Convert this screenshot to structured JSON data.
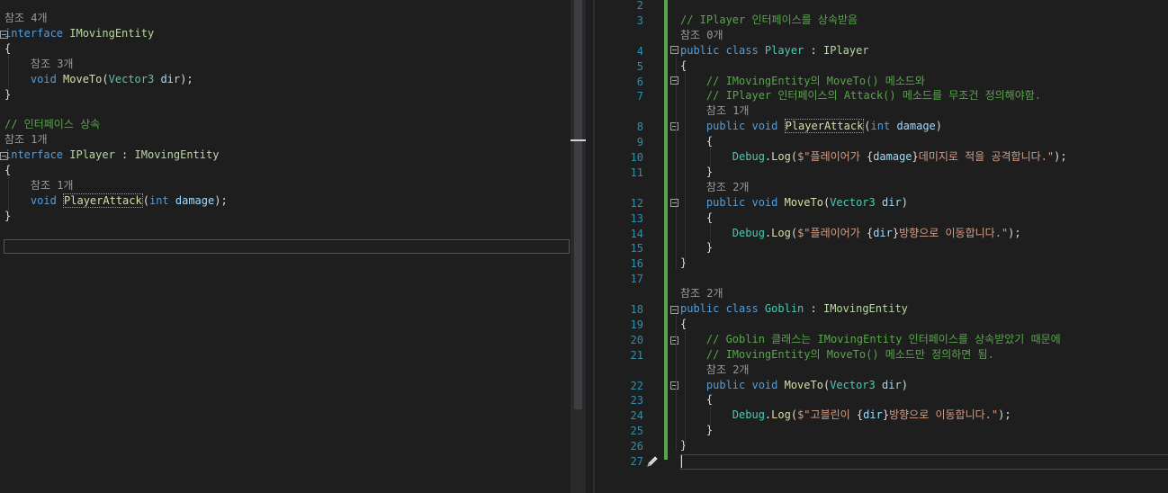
{
  "left_editor": {
    "lines": [
      [
        {
          "t": "참조 4개",
          "c": "lens"
        }
      ],
      [
        {
          "t": "interface ",
          "c": "kw"
        },
        {
          "t": "IMovingEntity",
          "c": "iface"
        }
      ],
      [
        {
          "t": "{",
          "c": "plain"
        }
      ],
      [
        {
          "t": "    참조 3개",
          "c": "lens"
        }
      ],
      [
        {
          "t": "    void ",
          "c": "kw"
        },
        {
          "t": "MoveTo",
          "c": "fn"
        },
        {
          "t": "(",
          "c": "plain"
        },
        {
          "t": "Vector3",
          "c": "cls"
        },
        {
          "t": " ",
          "c": "plain"
        },
        {
          "t": "dir",
          "c": "param"
        },
        {
          "t": ");",
          "c": "plain"
        }
      ],
      [
        {
          "t": "}",
          "c": "plain"
        }
      ],
      [],
      [
        {
          "t": "// 인터페이스 상속",
          "c": "cm"
        }
      ],
      [
        {
          "t": "참조 1개",
          "c": "lens"
        }
      ],
      [
        {
          "t": "interface ",
          "c": "kw"
        },
        {
          "t": "IPlayer",
          "c": "iface"
        },
        {
          "t": " : ",
          "c": "plain"
        },
        {
          "t": "IMovingEntity",
          "c": "iface"
        }
      ],
      [
        {
          "t": "{",
          "c": "plain"
        }
      ],
      [
        {
          "t": "    참조 1개",
          "c": "lens"
        }
      ],
      [
        {
          "t": "    void ",
          "c": "kw"
        },
        {
          "t": "PlayerAttack",
          "c": "fn",
          "dotted": true
        },
        {
          "t": "(",
          "c": "plain"
        },
        {
          "t": "int ",
          "c": "kw"
        },
        {
          "t": "damage",
          "c": "param"
        },
        {
          "t": ");",
          "c": "plain"
        }
      ],
      [
        {
          "t": "}",
          "c": "plain"
        }
      ]
    ]
  },
  "right_editor": {
    "lines": [
      {
        "n": "2",
        "seg": []
      },
      {
        "n": "3",
        "seg": [
          {
            "t": "// IPlayer 인터페이스를 상속받음",
            "c": "cm"
          }
        ]
      },
      {
        "n": "",
        "seg": [
          {
            "t": "참조 0개",
            "c": "lens"
          }
        ]
      },
      {
        "n": "4",
        "seg": [
          {
            "t": "public class ",
            "c": "kw"
          },
          {
            "t": "Player",
            "c": "cls"
          },
          {
            "t": " : ",
            "c": "plain"
          },
          {
            "t": "IPlayer",
            "c": "iface"
          }
        ]
      },
      {
        "n": "5",
        "seg": [
          {
            "t": "{",
            "c": "plain"
          }
        ]
      },
      {
        "n": "6",
        "seg": [
          {
            "t": "    // IMovingEntity의 MoveTo() 메소드와",
            "c": "cm"
          }
        ]
      },
      {
        "n": "7",
        "seg": [
          {
            "t": "    // IPlayer 인터페이스의 Attack() 메소드를 무조건 정의해야함.",
            "c": "cm"
          }
        ]
      },
      {
        "n": "",
        "seg": [
          {
            "t": "    참조 1개",
            "c": "lens"
          }
        ]
      },
      {
        "n": "8",
        "seg": [
          {
            "t": "    public void ",
            "c": "kw"
          },
          {
            "t": "PlayerAttack",
            "c": "fn",
            "dotted": true
          },
          {
            "t": "(",
            "c": "plain"
          },
          {
            "t": "int ",
            "c": "kw"
          },
          {
            "t": "damage",
            "c": "param"
          },
          {
            "t": ")",
            "c": "plain"
          }
        ]
      },
      {
        "n": "9",
        "seg": [
          {
            "t": "    {",
            "c": "plain"
          }
        ]
      },
      {
        "n": "10",
        "seg": [
          {
            "t": "        ",
            "c": "plain"
          },
          {
            "t": "Debug",
            "c": "cls"
          },
          {
            "t": ".",
            "c": "plain"
          },
          {
            "t": "Log",
            "c": "fn"
          },
          {
            "t": "(",
            "c": "plain"
          },
          {
            "t": "$\"플레이어가 ",
            "c": "str"
          },
          {
            "t": "{",
            "c": "plain"
          },
          {
            "t": "damage",
            "c": "param"
          },
          {
            "t": "}",
            "c": "plain"
          },
          {
            "t": "데미지로 적을 공격합니다.\"",
            "c": "str"
          },
          {
            "t": ");",
            "c": "plain"
          }
        ]
      },
      {
        "n": "11",
        "seg": [
          {
            "t": "    }",
            "c": "plain"
          }
        ]
      },
      {
        "n": "",
        "seg": [
          {
            "t": "    참조 2개",
            "c": "lens"
          }
        ]
      },
      {
        "n": "12",
        "seg": [
          {
            "t": "    public void ",
            "c": "kw"
          },
          {
            "t": "MoveTo",
            "c": "fn"
          },
          {
            "t": "(",
            "c": "plain"
          },
          {
            "t": "Vector3",
            "c": "cls"
          },
          {
            "t": " ",
            "c": "plain"
          },
          {
            "t": "dir",
            "c": "param"
          },
          {
            "t": ")",
            "c": "plain"
          }
        ]
      },
      {
        "n": "13",
        "seg": [
          {
            "t": "    {",
            "c": "plain"
          }
        ]
      },
      {
        "n": "14",
        "seg": [
          {
            "t": "        ",
            "c": "plain"
          },
          {
            "t": "Debug",
            "c": "cls"
          },
          {
            "t": ".",
            "c": "plain"
          },
          {
            "t": "Log",
            "c": "fn"
          },
          {
            "t": "(",
            "c": "plain"
          },
          {
            "t": "$\"플레이어가 ",
            "c": "str"
          },
          {
            "t": "{",
            "c": "plain"
          },
          {
            "t": "dir",
            "c": "param"
          },
          {
            "t": "}",
            "c": "plain"
          },
          {
            "t": "방향으로 이동합니다.\"",
            "c": "str"
          },
          {
            "t": ");",
            "c": "plain"
          }
        ]
      },
      {
        "n": "15",
        "seg": [
          {
            "t": "    }",
            "c": "plain"
          }
        ]
      },
      {
        "n": "16",
        "seg": [
          {
            "t": "}",
            "c": "plain"
          }
        ]
      },
      {
        "n": "17",
        "seg": []
      },
      {
        "n": "",
        "seg": [
          {
            "t": "참조 2개",
            "c": "lens"
          }
        ]
      },
      {
        "n": "18",
        "seg": [
          {
            "t": "public class ",
            "c": "kw"
          },
          {
            "t": "Goblin",
            "c": "cls"
          },
          {
            "t": " : ",
            "c": "plain"
          },
          {
            "t": "IMovingEntity",
            "c": "iface"
          }
        ]
      },
      {
        "n": "19",
        "seg": [
          {
            "t": "{",
            "c": "plain"
          }
        ]
      },
      {
        "n": "20",
        "seg": [
          {
            "t": "    // Goblin 클래스는 IMovingEntity 인터페이스를 상속받았기 때문에",
            "c": "cm"
          }
        ]
      },
      {
        "n": "21",
        "seg": [
          {
            "t": "    // IMovingEntity의 MoveTo() 메소드만 정의하면 됨.",
            "c": "cm"
          }
        ]
      },
      {
        "n": "",
        "seg": [
          {
            "t": "    참조 2개",
            "c": "lens"
          }
        ]
      },
      {
        "n": "22",
        "seg": [
          {
            "t": "    public void ",
            "c": "kw"
          },
          {
            "t": "MoveTo",
            "c": "fn"
          },
          {
            "t": "(",
            "c": "plain"
          },
          {
            "t": "Vector3",
            "c": "cls"
          },
          {
            "t": " ",
            "c": "plain"
          },
          {
            "t": "dir",
            "c": "param"
          },
          {
            "t": ")",
            "c": "plain"
          }
        ]
      },
      {
        "n": "23",
        "seg": [
          {
            "t": "    {",
            "c": "plain"
          }
        ]
      },
      {
        "n": "24",
        "seg": [
          {
            "t": "        ",
            "c": "plain"
          },
          {
            "t": "Debug",
            "c": "cls"
          },
          {
            "t": ".",
            "c": "plain"
          },
          {
            "t": "Log",
            "c": "fn"
          },
          {
            "t": "(",
            "c": "plain"
          },
          {
            "t": "$\"고블린이 ",
            "c": "str"
          },
          {
            "t": "{",
            "c": "plain"
          },
          {
            "t": "dir",
            "c": "param"
          },
          {
            "t": "}",
            "c": "plain"
          },
          {
            "t": "방향으로 이동합니다.\"",
            "c": "str"
          },
          {
            "t": ");",
            "c": "plain"
          }
        ]
      },
      {
        "n": "25",
        "seg": [
          {
            "t": "    }",
            "c": "plain"
          }
        ]
      },
      {
        "n": "26",
        "seg": [
          {
            "t": "}",
            "c": "plain"
          }
        ]
      },
      {
        "n": "27",
        "seg": []
      }
    ]
  },
  "icons": {
    "edit_marker": "pencil-icon"
  },
  "colors": {
    "background": "#1e1e1e",
    "keyword": "#569cd6",
    "interface": "#b8d7a3",
    "class": "#4ec9b0",
    "method": "#dcdcaa",
    "parameter": "#9cdcfe",
    "string": "#d69d85",
    "comment": "#57a64a",
    "line_number": "#2b91af",
    "codelens": "#999999"
  }
}
